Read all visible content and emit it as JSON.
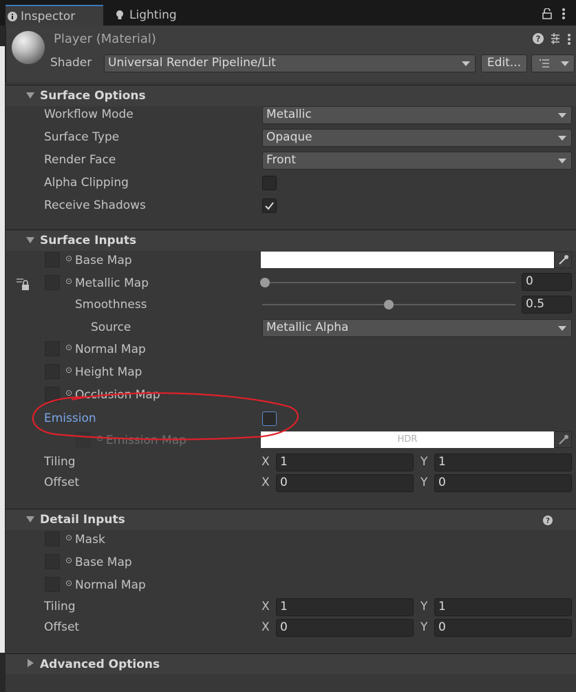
{
  "tabs": {
    "inspector": "Inspector",
    "lighting": "Lighting"
  },
  "header": {
    "material_title": "Player (Material)",
    "shader_label": "Shader",
    "shader_value": "Universal Render Pipeline/Lit",
    "edit_button": "Edit..."
  },
  "surface_options": {
    "title": "Surface Options",
    "workflow_mode_label": "Workflow Mode",
    "workflow_mode_value": "Metallic",
    "surface_type_label": "Surface Type",
    "surface_type_value": "Opaque",
    "render_face_label": "Render Face",
    "render_face_value": "Front",
    "alpha_clipping_label": "Alpha Clipping",
    "receive_shadows_label": "Receive Shadows"
  },
  "surface_inputs": {
    "title": "Surface Inputs",
    "base_map_label": "Base Map",
    "metallic_map_label": "Metallic Map",
    "metallic_value": "0",
    "metallic_level": 0,
    "smoothness_label": "Smoothness",
    "smoothness_value": "0.5",
    "smoothness_level": 0.5,
    "source_label": "Source",
    "source_value": "Metallic Alpha",
    "normal_map_label": "Normal Map",
    "height_map_label": "Height Map",
    "occlusion_map_label": "Occlusion Map",
    "emission_label": "Emission",
    "emission_map_label": "Emission Map",
    "hdr_label": "HDR",
    "tiling_label": "Tiling",
    "tiling_x": "1",
    "tiling_y": "1",
    "offset_label": "Offset",
    "offset_x": "0",
    "offset_y": "0",
    "x_label": "X",
    "y_label": "Y"
  },
  "detail_inputs": {
    "title": "Detail Inputs",
    "mask_label": "Mask",
    "base_map_label": "Base Map",
    "normal_map_label": "Normal Map",
    "tiling_label": "Tiling",
    "tiling_x": "1",
    "tiling_y": "1",
    "offset_label": "Offset",
    "offset_x": "0",
    "offset_y": "0",
    "x_label": "X",
    "y_label": "Y"
  },
  "advanced_options": {
    "title": "Advanced Options"
  },
  "colors": {
    "accent": "#3a79bb",
    "emission_label": "#7aa7e8",
    "annotation_circle": "#e0202a"
  }
}
